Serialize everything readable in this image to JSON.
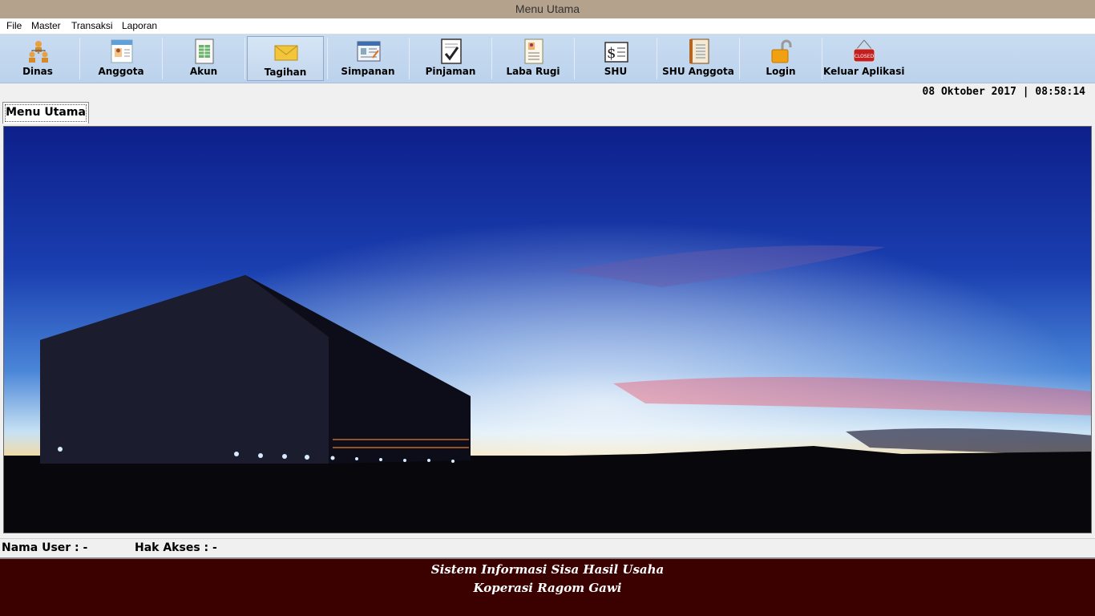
{
  "window": {
    "title": "Menu Utama"
  },
  "menu": [
    "File",
    "Master",
    "Transaksi",
    "Laporan"
  ],
  "toolbar": [
    {
      "label": "Dinas",
      "icon": "organization-icon"
    },
    {
      "label": "Anggota",
      "icon": "id-card-icon"
    },
    {
      "label": "Akun",
      "icon": "spreadsheet-icon"
    },
    {
      "label": "Tagihan",
      "icon": "envelope-icon",
      "active": true
    },
    {
      "label": "Simpanan",
      "icon": "form-icon"
    },
    {
      "label": "Pinjaman",
      "icon": "checklist-icon"
    },
    {
      "label": "Laba Rugi",
      "icon": "report-icon"
    },
    {
      "label": "SHU",
      "icon": "dollar-document-icon"
    },
    {
      "label": "SHU Anggota",
      "icon": "notebook-icon"
    },
    {
      "label": "Login",
      "icon": "padlock-icon"
    },
    {
      "label": "Keluar Aplikasi",
      "icon": "closed-sign-icon"
    }
  ],
  "datetime": "08 Oktober 2017 | 08:58:14",
  "tab": {
    "label": "Menu Utama"
  },
  "status": {
    "user": "Nama User : -",
    "access": "Hak Akses : -"
  },
  "footer": {
    "line1": "Sistem Informasi Sisa Hasil Usaha",
    "line2": "Koperasi Ragom Gawi"
  }
}
